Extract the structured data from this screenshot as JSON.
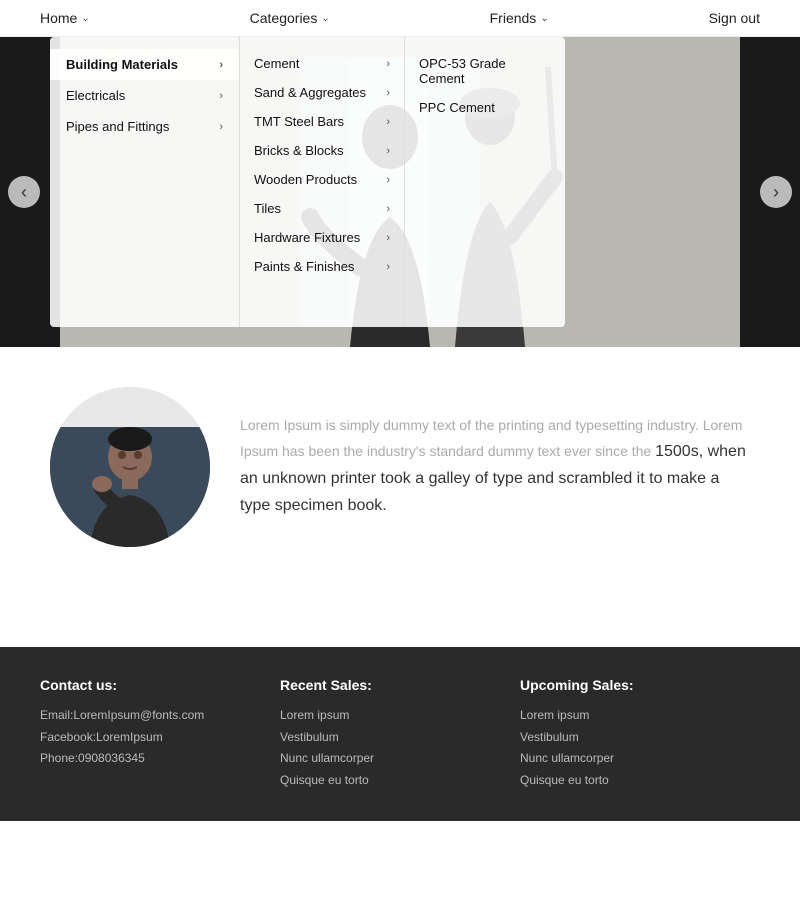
{
  "nav": {
    "home": "Home",
    "categories": "Categories",
    "friends": "Friends",
    "signout": "Sign out"
  },
  "sidebar": {
    "items": [
      {
        "label": "Building Materials",
        "active": true
      },
      {
        "label": "Electricals"
      },
      {
        "label": "Pipes and Fittings"
      }
    ]
  },
  "submenu": {
    "items": [
      {
        "label": "Cement"
      },
      {
        "label": "Sand & Aggregates"
      },
      {
        "label": "TMT Steel Bars"
      },
      {
        "label": "Bricks & Blocks"
      },
      {
        "label": "Wooden Products"
      },
      {
        "label": "Tiles"
      },
      {
        "label": "Hardware Fixtures"
      },
      {
        "label": "Paints & Finishes"
      }
    ]
  },
  "products": {
    "cement": [
      {
        "label": "OPC-53 Grade Cement"
      },
      {
        "label": "PPC Cement"
      }
    ]
  },
  "lorem": {
    "faded": "Lorem Ipsum is simply dummy text of the printing and typesetting industry. Lorem Ipsum has been the industry's standard dummy text ever since the",
    "bold": "1500s, when an unknown printer took a galley of type and scrambled it to make a type specimen book."
  },
  "footer": {
    "contact": {
      "title": "Contact us:",
      "email": "Email:LoremIpsum@fonts.com",
      "facebook": "Facebook:LoremIpsum",
      "phone": "Phone:0908036345"
    },
    "recent": {
      "title": "Recent Sales:",
      "items": [
        "Lorem ipsum",
        "Vestibulum",
        "Nunc ullamcorper",
        "Quisque eu torto"
      ]
    },
    "upcoming": {
      "title": "Upcoming Sales:",
      "items": [
        "Lorem ipsum",
        "Vestibulum",
        "Nunc ullamcorper",
        "Quisque eu torto"
      ]
    }
  }
}
